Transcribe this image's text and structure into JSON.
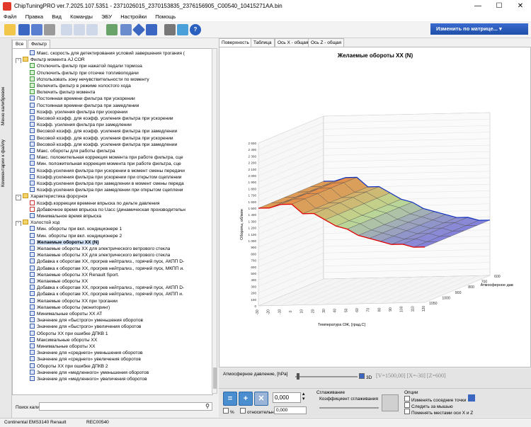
{
  "window": {
    "title": "ChipTuningPRO ver.7.2025.107.5351 - 2371026015_2370153835_2376156905_C00540_10415271AA.bin"
  },
  "menu": [
    "Файл",
    "Правка",
    "Вид",
    "Команды",
    "ЭБУ",
    "Настройки",
    "Помощь"
  ],
  "toolbar": {
    "matrix_label": "Изменить по матрице..."
  },
  "left_side_tabs": [
    "Меню калибровок",
    "Комментарии к файлу"
  ],
  "panel_tabs": [
    "Все",
    "Фильтр"
  ],
  "tree": [
    {
      "label": "Макс. скорость для детектирования условий завершения трогания (",
      "icon": "table",
      "indent": 2
    },
    {
      "label": "Фильтр момента AJ COR",
      "icon": "folder",
      "indent": 1,
      "toggle": "-"
    },
    {
      "label": "Отключить фильтр при нажатой педали тормоза",
      "icon": "check",
      "indent": 2
    },
    {
      "label": "Отключить фильтр при отсечке топливоподачи",
      "icon": "check",
      "indent": 2
    },
    {
      "label": "Использовать зону нечувствительности по моменту",
      "icon": "check",
      "indent": 2
    },
    {
      "label": "Включить фильтр в режиме холостого хода",
      "icon": "check",
      "indent": 2
    },
    {
      "label": "Включить фильтр момента",
      "icon": "check",
      "indent": 2
    },
    {
      "label": "Постоянная времени фильтра при ускорении",
      "icon": "table",
      "indent": 2
    },
    {
      "label": "Постоянная времени фильтра при замедлении",
      "icon": "table",
      "indent": 2
    },
    {
      "label": "Коэфф. усиления фильтра при ускорении",
      "icon": "table",
      "indent": 2
    },
    {
      "label": "Весовой коэфф. для коэфф. усиления фильтра при ускорении",
      "icon": "table",
      "indent": 2
    },
    {
      "label": "Коэфф. усиления фильтра при замедлении",
      "icon": "table",
      "indent": 2
    },
    {
      "label": "Весовой коэфф. для коэфф. усиления фильтра при замедлении",
      "icon": "table",
      "indent": 2
    },
    {
      "label": "Весовой коэфф. для коэфф. усиления фильтра при ускорении",
      "icon": "table",
      "indent": 2
    },
    {
      "label": "Весовой коэфф. для коэфф. усиления фильтра при замедлении",
      "icon": "table",
      "indent": 2
    },
    {
      "label": "Макс. обороты для работы фильтра",
      "icon": "table",
      "indent": 2
    },
    {
      "label": "Макс. положительная коррекция момента при работе фильтра, сце",
      "icon": "table",
      "indent": 2
    },
    {
      "label": "Мин. положительная коррекция момента при работе фильтра, сце",
      "icon": "table",
      "indent": 2
    },
    {
      "label": "Коэфф.усиления фильтра при ускорении в момент смены передачи",
      "icon": "table",
      "indent": 2
    },
    {
      "label": "Коэфф.усиления фильтра при ускорении при открытом сцеплении",
      "icon": "table",
      "indent": 2
    },
    {
      "label": "Коэфф.усиления фильтра при замедлении в момент смены переда",
      "icon": "table",
      "indent": 2
    },
    {
      "label": "Коэфф.усиления фильтра при замедлении при открытом сцеплени",
      "icon": "table",
      "indent": 2
    },
    {
      "label": "Характеристика форсунок",
      "icon": "folder",
      "indent": 1,
      "toggle": "-"
    },
    {
      "label": "Коэфф.коррекции времени впрыска по дельте давления",
      "icon": "graph",
      "indent": 2
    },
    {
      "label": "Добавочное время впрыска по Uacc (динамическая производительн",
      "icon": "graph",
      "indent": 2
    },
    {
      "label": "Минимальное время впрыска",
      "icon": "table",
      "indent": 2
    },
    {
      "label": "Холостой ход",
      "icon": "folder",
      "indent": 1,
      "toggle": "-"
    },
    {
      "label": "Мин. обороты при вкл. кондиционере 1",
      "icon": "table",
      "indent": 2
    },
    {
      "label": "Мин. обороты при вкл. кондиционере 2",
      "icon": "table",
      "indent": 2
    },
    {
      "label": "Желаемые обороты ХХ (N)",
      "icon": "table",
      "indent": 2,
      "selected": true
    },
    {
      "label": "Желаемые обороты ХХ для электрического ветрового стекла",
      "icon": "table",
      "indent": 2
    },
    {
      "label": "Желаемые обороты ХХ для электрического ветрового стекла",
      "icon": "table",
      "indent": 2
    },
    {
      "label": "Добавка к оборотам ХХ, прогрев нейтрализ., горячий пуск, АКПП D-",
      "icon": "table",
      "indent": 2
    },
    {
      "label": "Добавка к оборотам ХХ, прогрев нейтрализ., горячий пуск, МКПП и.",
      "icon": "table",
      "indent": 2
    },
    {
      "label": "Желаемые обороты ХХ Renault Sport.",
      "icon": "table",
      "indent": 2
    },
    {
      "label": "Желаемые обороты ХХ",
      "icon": "table",
      "indent": 2
    },
    {
      "label": "Добавка к оборотам ХХ, прогрев нейтрализ., горячий пуск, АКПП D-",
      "icon": "table",
      "indent": 2
    },
    {
      "label": "Добавка к оборотам ХХ, прогрев нейтрализ., горячий пуск, АКПП и.",
      "icon": "table",
      "indent": 2
    },
    {
      "label": "Желаемые обороты ХХ при трогании",
      "icon": "table",
      "indent": 2
    },
    {
      "label": "Желаемые обороты (мониторинг)",
      "icon": "table",
      "indent": 2
    },
    {
      "label": "Минимальные обороты ХХ AT",
      "icon": "table",
      "indent": 2
    },
    {
      "label": "Значение для «быстрого» уменьшения оборотов",
      "icon": "table",
      "indent": 2
    },
    {
      "label": "Значение для «быстрого» увеличения оборотов",
      "icon": "table",
      "indent": 2
    },
    {
      "label": "Обороты ХХ при ошибке ДПКВ 1",
      "icon": "table",
      "indent": 2
    },
    {
      "label": "Максимальные обороты ХХ",
      "icon": "table",
      "indent": 2
    },
    {
      "label": "Минимальные обороты ХХ",
      "icon": "table",
      "indent": 2
    },
    {
      "label": "Значение для «среднего» уменьшения оборотов",
      "icon": "table",
      "indent": 2
    },
    {
      "label": "Значение для «среднего» увеличения оборотов",
      "icon": "table",
      "indent": 2
    },
    {
      "label": "Обороты ХХ при ошибке ДПКВ 2",
      "icon": "table",
      "indent": 2
    },
    {
      "label": "Значение для «медленного» уменьшения оборотов",
      "icon": "table",
      "indent": 2
    },
    {
      "label": "Значение для «медленного» увеличения оборотов",
      "icon": "table",
      "indent": 2
    }
  ],
  "search": {
    "label": "Поиск калибровки"
  },
  "status": {
    "ecu": "Continental EMS3140 Renault",
    "code": "REC00540"
  },
  "chart_tabs": [
    "Поверхность",
    "Таблица",
    "Ось X - общая",
    "Ось Z - общая"
  ],
  "chart_data": {
    "type": "surface3d",
    "title": "Желаемые обороты ХХ (N)",
    "xlabel": "Температура ОЖ, [град.С]",
    "ylabel": "Атмосферное дав",
    "zlabel": "Обороты, об/мин",
    "x_ticks": [
      "-30",
      "-20",
      "-10",
      "0",
      "10",
      "20",
      "30",
      "40",
      "50",
      "60",
      "70",
      "80",
      "90",
      "100",
      "110",
      "120"
    ],
    "y_ticks": [
      "600",
      "700",
      "800",
      "900",
      "1000",
      "1050"
    ],
    "z_ticks": [
      "0",
      "50",
      "100",
      "150",
      "200",
      "250",
      "300",
      "350",
      "400",
      "450",
      "500",
      "550",
      "600",
      "650",
      "700",
      "750",
      "800",
      "850",
      "900",
      "950",
      "1 000",
      "1 050",
      "1 100",
      "1 150",
      "1 200",
      "1 250",
      "1 300",
      "1 350",
      "1 400",
      "1 450",
      "1 500",
      "1 550",
      "1 600",
      "1 650",
      "1 700",
      "1 750",
      "1 800",
      "1 850",
      "1 900",
      "1 950",
      "2 000",
      "2 050",
      "2 100",
      "2 150",
      "2 200",
      "2 250",
      "2 300",
      "2 350",
      "2 400",
      "2 450",
      "2 500"
    ],
    "zlim": [
      0,
      2500
    ],
    "profile": [
      1500,
      1500,
      1550,
      1550,
      1400,
      1400,
      1300,
      1200,
      1150,
      1050,
      1000,
      950,
      900,
      900,
      850,
      850
    ],
    "surface_note": "",
    "colors": {
      "high": "#e0873c",
      "mid": "#b8d88a",
      "low": "#7b78d6",
      "edge_front": "#e00000",
      "edge_back": "#1030c0"
    }
  },
  "slider": {
    "label": "Атмосферное давление, [hPa]",
    "checkbox_3d": "3D",
    "readout": "[V=1500,00] [X=-30] [Z=600]"
  },
  "controls": {
    "value1": "0,000",
    "value2": "0,000",
    "percent_label": "%",
    "relative_label": "относительно",
    "smoothing_title": "Сглаживание",
    "smoothing_label": "Коэффициент сглаживания",
    "options_title": "Опции",
    "options": [
      "Изменять соседние точки",
      "Следить за мышью",
      "Поменять местами оси X и Z"
    ]
  }
}
